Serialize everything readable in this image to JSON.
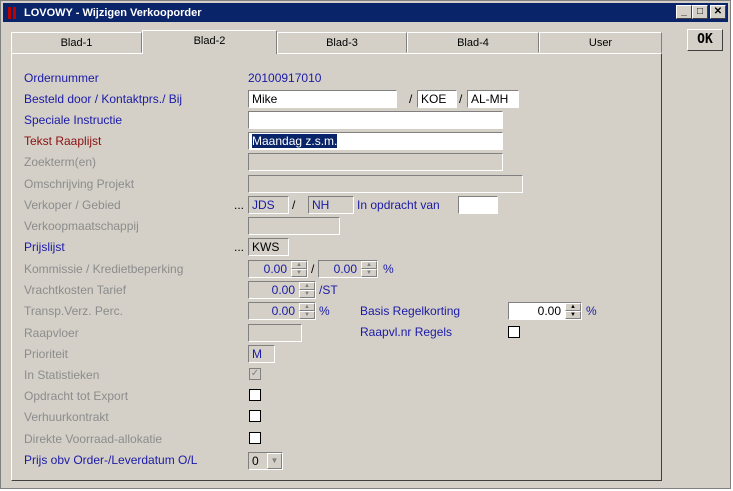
{
  "window": {
    "title": "LOVOWY - Wijzigen Verkooporder",
    "minimize": "_",
    "maximize": "□",
    "close": "✕",
    "ok_label": "OK"
  },
  "tabs": [
    "Blad-1",
    "Blad-2",
    "Blad-3",
    "Blad-4",
    "User"
  ],
  "active_tab": "Blad-2",
  "labels": {
    "ordernummer": "Ordernummer",
    "besteld_door": "Besteld door / Kontaktprs./ Bij",
    "speciale_instructie": "Speciale Instructie",
    "tekst_raaplijst": "Tekst Raaplijst",
    "zoekterm": "Zoekterm(en)",
    "omschrijving_projekt": "Omschrijving Projekt",
    "verkoper_gebied": "Verkoper / Gebied",
    "verkoopmaatschappij": "Verkoopmaatschappij",
    "prijslijst": "Prijslijst",
    "kommissie": "Kommissie / Kredietbeperking",
    "vrachtkosten": "Vrachtkosten Tarief",
    "transp_verz": "Transp.Verz. Perc.",
    "raapvloer": "Raapvloer",
    "prioriteit": "Prioriteit",
    "in_statistieken": "In Statistieken",
    "opdracht_export": "Opdracht tot Export",
    "verhuurkontrakt": "Verhuurkontrakt",
    "direkte_voorraad": "Direkte Voorraad-allokatie",
    "prijs_obv": "Prijs obv Order-/Leverdatum O/L",
    "in_opdracht_van": "In opdracht van",
    "basis_regelkorting": "Basis Regelkorting",
    "raapvl_regels": "Raapvl.nr Regels"
  },
  "values": {
    "ordernummer": "20100917010",
    "besteld_door": "Mike",
    "kontaktprs": "KOE",
    "bij": "AL-MH",
    "speciale_instructie": "",
    "tekst_raaplijst": "Maandag z.s.m.",
    "zoekterm": "",
    "omschrijving_projekt": "",
    "verkoper": "JDS",
    "gebied": "NH",
    "in_opdracht_van": "",
    "verkoopmaatschappij": "",
    "prijslijst": "KWS",
    "kommissie": "0.00",
    "kredietbeperking": "0.00",
    "vrachtkosten": "0.00",
    "transp_verz": "0.00",
    "basis_regelkorting": "0.00",
    "raapvloer": "",
    "prioriteit": "M",
    "prijs_obv": "0"
  },
  "separators": {
    "slash": "/",
    "ellipsis": "...",
    "percent": "%",
    "per_st": "/ST"
  },
  "checks": {
    "in_statistieken": true,
    "opdracht_export": false,
    "verhuurkontrakt": false,
    "direkte_voorraad": false,
    "raapvl_regels": false
  }
}
